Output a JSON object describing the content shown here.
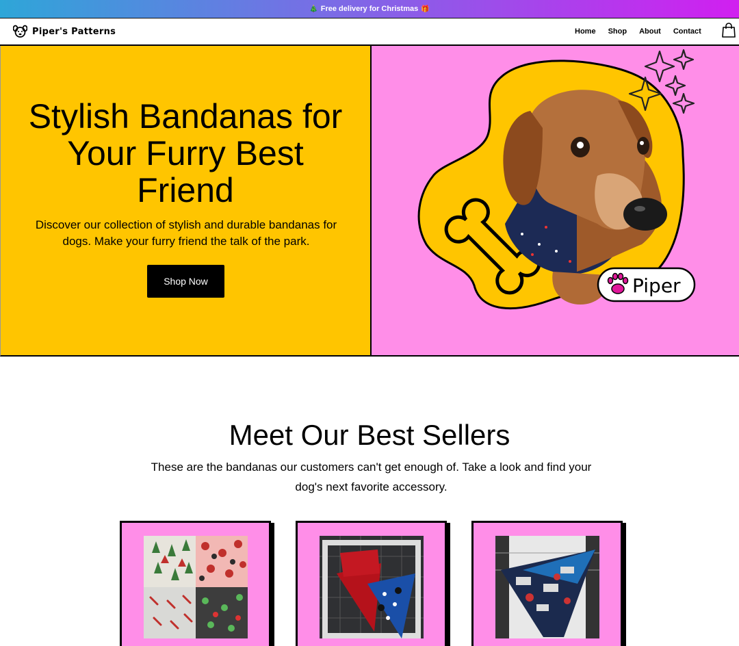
{
  "announcement": {
    "left_emoji": "🎄",
    "text": "Free delivery for Christmas",
    "right_emoji": "🎁"
  },
  "header": {
    "brand": "Piper's Patterns",
    "nav": [
      "Home",
      "Shop",
      "About",
      "Contact"
    ]
  },
  "hero": {
    "title": "Stylish Bandanas for Your Furry Best Friend",
    "text": "Discover our collection of stylish and durable bandanas for dogs. Make your furry friend the talk of the park.",
    "cta": "Shop Now",
    "dog_tag": "Piper"
  },
  "best_sellers": {
    "title": "Meet Our Best Sellers",
    "text": "These are the bandanas our customers can't get enough of. Take a look and find your dog's next favorite accessory.",
    "products": [
      {
        "image": "christmas-fabric-swatches"
      },
      {
        "image": "red-and-blue-bandanas"
      },
      {
        "image": "new-york-bandana"
      }
    ]
  },
  "colors": {
    "yellow": "#ffc500",
    "pink": "#ff8ee8",
    "black": "#000000"
  }
}
